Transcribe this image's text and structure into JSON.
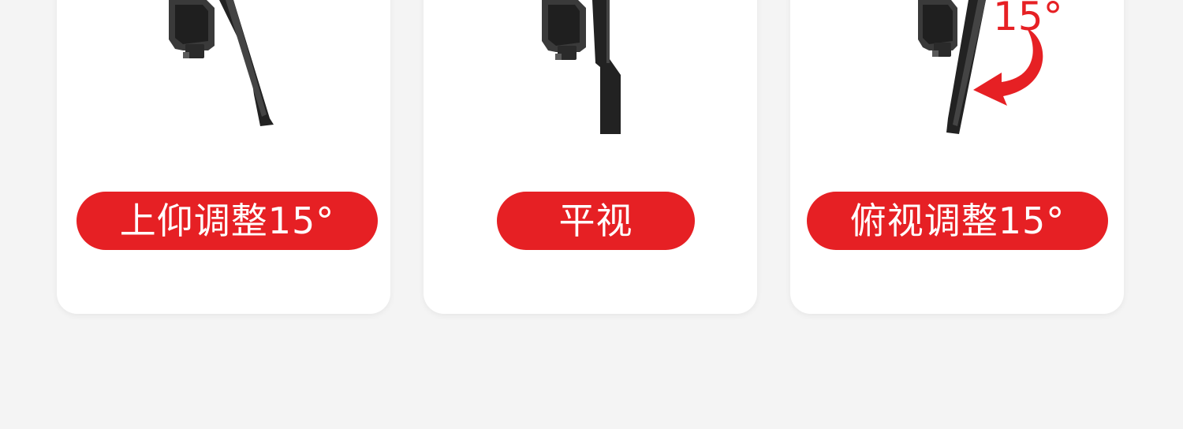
{
  "cards": [
    {
      "label": "上仰调整15°"
    },
    {
      "label": "平视"
    },
    {
      "label": "俯视调整15°",
      "angle_text": "15°"
    }
  ],
  "colors": {
    "accent": "#e62024",
    "background": "#f4f4f4",
    "card": "#ffffff",
    "device": "#222222"
  },
  "icons": {
    "mount": "phone-mount-arm-icon",
    "arrow": "curved-arrow-icon"
  }
}
